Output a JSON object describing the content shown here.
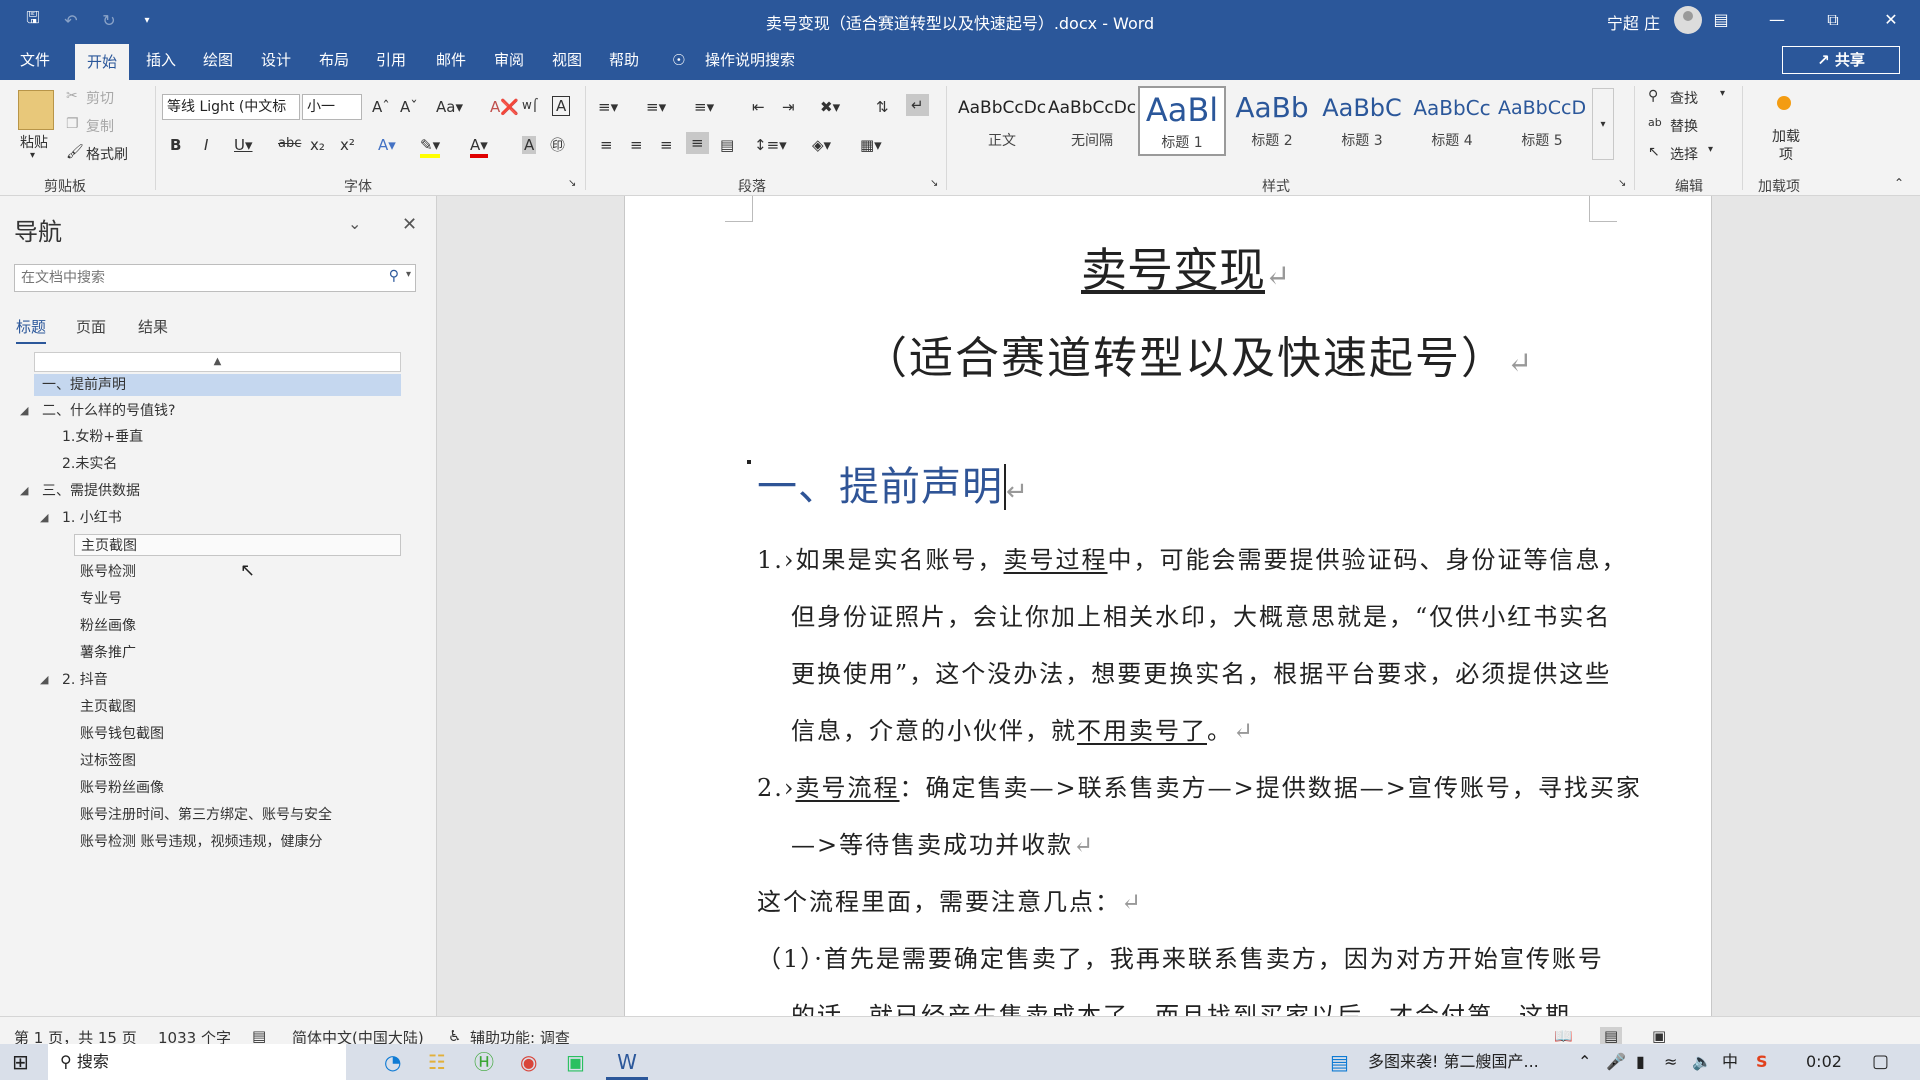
{
  "window": {
    "title": "卖号变现（适合赛道转型以及快速起号）.docx - Word",
    "user": "宁超 庄",
    "quick_access": [
      "save-icon",
      "undo-icon",
      "redo-icon",
      "customize-icon"
    ],
    "controls": [
      "ribbon-display-icon",
      "minimize-icon",
      "restore-icon",
      "close-icon"
    ]
  },
  "menu": {
    "tabs": [
      "文件",
      "开始",
      "插入",
      "绘图",
      "设计",
      "布局",
      "引用",
      "邮件",
      "审阅",
      "视图",
      "帮助"
    ],
    "active": "开始",
    "tell_me": "操作说明搜索",
    "share": "共享"
  },
  "ribbon": {
    "clipboard": {
      "paste": "粘贴",
      "cut": "剪切",
      "copy": "复制",
      "format_painter": "格式刷",
      "label": "剪贴板"
    },
    "font": {
      "name": "等线 Light (中文标",
      "size": "小一",
      "label": "字体"
    },
    "paragraph": {
      "label": "段落"
    },
    "styles": {
      "label": "样式",
      "items": [
        {
          "preview": "AaBbCcDc",
          "name": "正文"
        },
        {
          "preview": "AaBbCcDc",
          "name": "无间隔"
        },
        {
          "preview": "AaBl",
          "name": "标题 1"
        },
        {
          "preview": "AaBb",
          "name": "标题 2"
        },
        {
          "preview": "AaBbC",
          "name": "标题 3"
        },
        {
          "preview": "AaBbCc",
          "name": "标题 4"
        },
        {
          "preview": "AaBbCcD",
          "name": "标题 5"
        }
      ],
      "selected": "标题 1"
    },
    "editing": {
      "find": "查找",
      "replace": "替换",
      "select": "选择",
      "label": "编辑"
    },
    "addins": {
      "button": "加载项",
      "label": "加载项"
    }
  },
  "nav": {
    "title": "导航",
    "search_placeholder": "在文档中搜索",
    "tabs": [
      "标题",
      "页面",
      "结果"
    ],
    "active_tab": "标题",
    "items": [
      {
        "text": "一、提前声明",
        "level": 1,
        "selected": true
      },
      {
        "text": "二、什么样的号值钱?",
        "level": 1,
        "expanded": true
      },
      {
        "text": "1.女粉+垂直",
        "level": 2
      },
      {
        "text": "2.未实名",
        "level": 2
      },
      {
        "text": "三、需提供数据",
        "level": 1,
        "expanded": true
      },
      {
        "text": "1. 小红书",
        "level": 2,
        "expanded": true
      },
      {
        "text": "主页截图",
        "level": 3,
        "hover": true
      },
      {
        "text": "账号检测",
        "level": 3
      },
      {
        "text": "专业号",
        "level": 3
      },
      {
        "text": "粉丝画像",
        "level": 3
      },
      {
        "text": "薯条推广",
        "level": 3
      },
      {
        "text": "2. 抖音",
        "level": 2,
        "expanded": true
      },
      {
        "text": "主页截图",
        "level": 3
      },
      {
        "text": "账号钱包截图",
        "level": 3
      },
      {
        "text": "过标签图",
        "level": 3
      },
      {
        "text": "账号粉丝画像",
        "level": 3
      },
      {
        "text": "账号注册时间、第三方绑定、账号与安全",
        "level": 3
      },
      {
        "text": "账号检测 账号违规，视频违规，健康分",
        "level": 3
      }
    ]
  },
  "document": {
    "title": "卖号变现",
    "subtitle": "（适合赛道转型以及快速起号）",
    "heading1": "一、提前声明",
    "p1": {
      "num": "1.",
      "line1_a": "如果是实名账号，",
      "line1_u": "卖号过程",
      "line1_b": "中，可能会需要提供验证码、身份证等信息，",
      "line2": "但身份证照片，会让你加上相关水印，大概意思就是，“仅供小红书实名",
      "line3": "更换使用”，这个没办法，想要更换实名，根据平台要求，必须提供这些",
      "line4_a": "信息，介意的小伙伴，就",
      "line4_u": "不用卖号了",
      "line4_b": "。"
    },
    "p2": {
      "num": "2.",
      "u": "卖号流程",
      "line1": "：确定售卖—>联系售卖方—>提供数据—>宣传账号，寻找买家",
      "line2": "—>等待售卖成功并收款"
    },
    "p3": "这个流程里面，需要注意几点：",
    "p4": "（1）·首先是需要确定售卖了，我再来联系售卖方，因为对方开始宣传账号",
    "p5": "的话，就已经产生售卖成本了，而且找到买家以后，才会付第…这期",
    "pilcrow": "↵"
  },
  "status": {
    "page": "第 1 页，共 15 页",
    "words": "1033 个字",
    "language": "简体中文(中国大陆)",
    "accessibility": "辅助功能: 调查"
  },
  "taskbar": {
    "search": "搜索",
    "news": "多图来袭! 第二艘国产...",
    "ime": "中",
    "clock": "0:02"
  }
}
